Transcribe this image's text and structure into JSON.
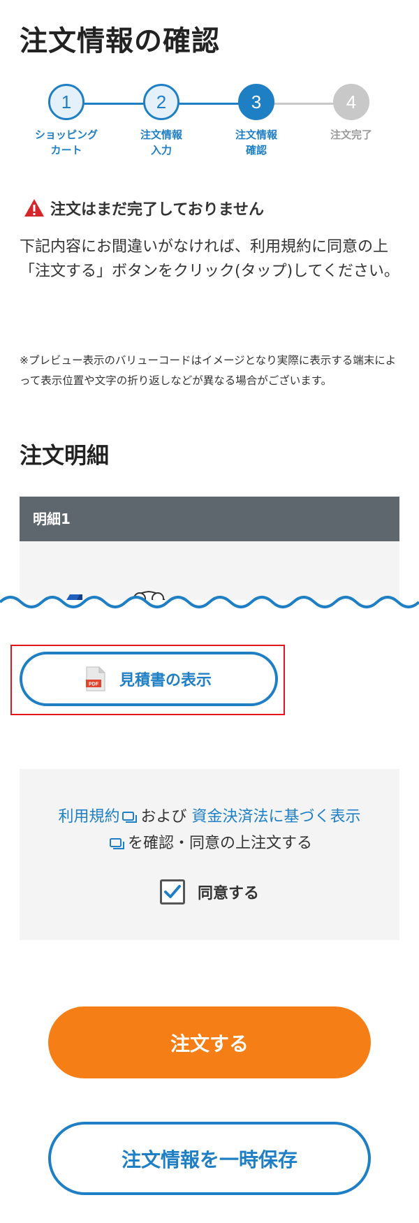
{
  "page": {
    "title": "注文情報の確認"
  },
  "stepper": {
    "steps": [
      {
        "number": "1",
        "label": "ショッピング\nカート",
        "state": "done"
      },
      {
        "number": "2",
        "label": "注文情報\n入力",
        "state": "done"
      },
      {
        "number": "3",
        "label": "注文情報\n確認",
        "state": "active"
      },
      {
        "number": "4",
        "label": "注文完了",
        "state": "todo"
      }
    ]
  },
  "warning": {
    "icon": "warning-triangle-icon",
    "text": "注文はまだ完了しておりません"
  },
  "lead": "下記内容にお間違いがなければ、利用規約に同意の上「注文する」ボタンをクリック(タップ)してください。",
  "note": "※プレビュー表示のバリューコードはイメージとなり実際に表示する端末によって表示位置や文字の折り返しなどが異なる場合がございます。",
  "details": {
    "title": "注文明細",
    "header": "明細1"
  },
  "pdf_button": {
    "label": "見積書の表示",
    "icon": "pdf-file-icon"
  },
  "agreement": {
    "terms_link": "利用規約",
    "and": "および",
    "law_link": "資金決済法に基づく表示",
    "suffix": "を確認・同意の上注文する",
    "checkbox_label": "同意する",
    "checked": true
  },
  "buttons": {
    "order": "注文する",
    "save": "注文情報を一時保存"
  },
  "colors": {
    "primary": "#1f7fc4",
    "accent": "#f57f16",
    "inactive": "#c8c8c8",
    "header_bg": "#5f676e",
    "highlight": "#e3141a"
  }
}
